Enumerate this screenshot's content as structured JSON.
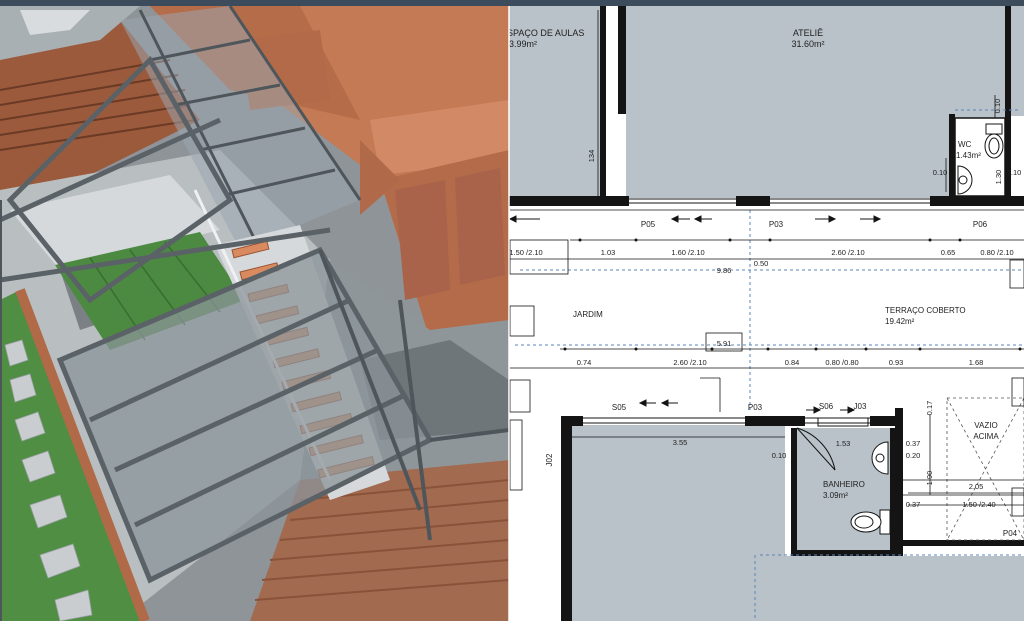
{
  "colors": {
    "top_bar": "#3c4c5c",
    "plan_room": "#b9c2c8",
    "plan_wall": "#141414",
    "render_wood": "#c47a55",
    "render_grass": "#4d8a41",
    "render_steel": "#5f676c"
  },
  "render": {
    "description_icon": "3d-isometric-render"
  },
  "plan": {
    "rooms": {
      "aulas_name": "SPAÇO DE AULAS",
      "aulas_area": "3.99m²",
      "atelie_name": "ATELIÊ",
      "atelie_area": "31.60m²",
      "wc_name": "WC",
      "wc_area": "1.43m²",
      "jardim_name": "JARDIM",
      "terraco_name": "TERRAÇO COBERTO",
      "terraco_area": "19.42m²",
      "banheiro_name": "BANHEIRO",
      "banheiro_area": "3.09m²",
      "vazio_line1": "VAZIO",
      "vazio_line2": "ACIMA"
    },
    "openings": {
      "p05": "P05",
      "p03_top": "P03",
      "p06": "P06",
      "s05": "S05",
      "p03_bottom": "P03",
      "s06": "S06",
      "j03": "J03",
      "j02": "J02",
      "p04": "P04"
    },
    "dims": {
      "d_010_top": "0.10",
      "d_134": "134",
      "d_010_wc": "0.10",
      "d_130": "1.30",
      "d_110": "1.10",
      "r1_150": "1.50 /2.10",
      "r1_103": "1.03",
      "r1_160": "1.60 /2.10",
      "r1_260": "2.60 /2.10",
      "r1_065": "0.65",
      "r1_080": "0.80 /2.10",
      "d_986": "9.86",
      "d_050": "0.50",
      "d_591": "5.91",
      "r2_074": "0.74",
      "r2_260": "2.60 /2.10",
      "r2_084": "0.84",
      "r2_080": "0.80 /0.80",
      "r2_093": "0.93",
      "r2_168": "1.68",
      "d_017": "0.17",
      "d_355": "3.55",
      "d_010_ban": "0.10",
      "d_153": "1.53",
      "d_037a": "0.37",
      "d_020": "0.20",
      "d_190": "1.90",
      "d_205": "2.05",
      "d_037b": "0.37",
      "d_150_240": "1.50 /2.40"
    }
  }
}
